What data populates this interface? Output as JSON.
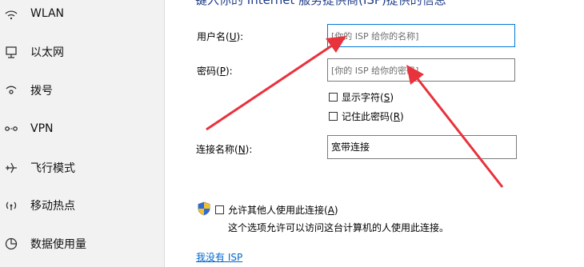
{
  "sidebar": {
    "items": [
      {
        "label": "WLAN",
        "icon": "wifi-icon"
      },
      {
        "label": "以太网",
        "icon": "ethernet-icon"
      },
      {
        "label": "拨号",
        "icon": "dialup-icon"
      },
      {
        "label": "VPN",
        "icon": "vpn-icon"
      },
      {
        "label": "飞行模式",
        "icon": "airplane-icon"
      },
      {
        "label": "移动热点",
        "icon": "hotspot-icon"
      },
      {
        "label": "数据使用量",
        "icon": "data-usage-icon"
      }
    ]
  },
  "dialog": {
    "heading": "键入你的 Internet 服务提供商(ISP)提供的信息",
    "username": {
      "label_prefix": "用户名(",
      "label_key": "U",
      "label_suffix": "):",
      "placeholder": "[你的 ISP 给你的名称]"
    },
    "password": {
      "label_prefix": "密码(",
      "label_key": "P",
      "label_suffix": "):",
      "placeholder": "[你的 ISP 给你的密码]"
    },
    "show_chars": {
      "prefix": "显示字符(",
      "key": "S",
      "suffix": ")",
      "checked": false
    },
    "remember_password": {
      "prefix": "记住此密码(",
      "key": "R",
      "suffix": ")",
      "checked": false
    },
    "connection_name": {
      "label_prefix": "连接名称(",
      "label_key": "N",
      "label_suffix": "):",
      "value": "宽带连接"
    },
    "allow_others": {
      "prefix": "允许其他人使用此连接(",
      "key": "A",
      "suffix": ")",
      "checked": false
    },
    "allow_others_desc": "这个选项允许可以访问这台计算机的人使用此连接。",
    "no_isp_link": "我没有 ISP"
  },
  "colors": {
    "accent": "#0078d7",
    "arrow": "#e8323c",
    "heading": "#1f3c88",
    "link": "#0066cc"
  }
}
